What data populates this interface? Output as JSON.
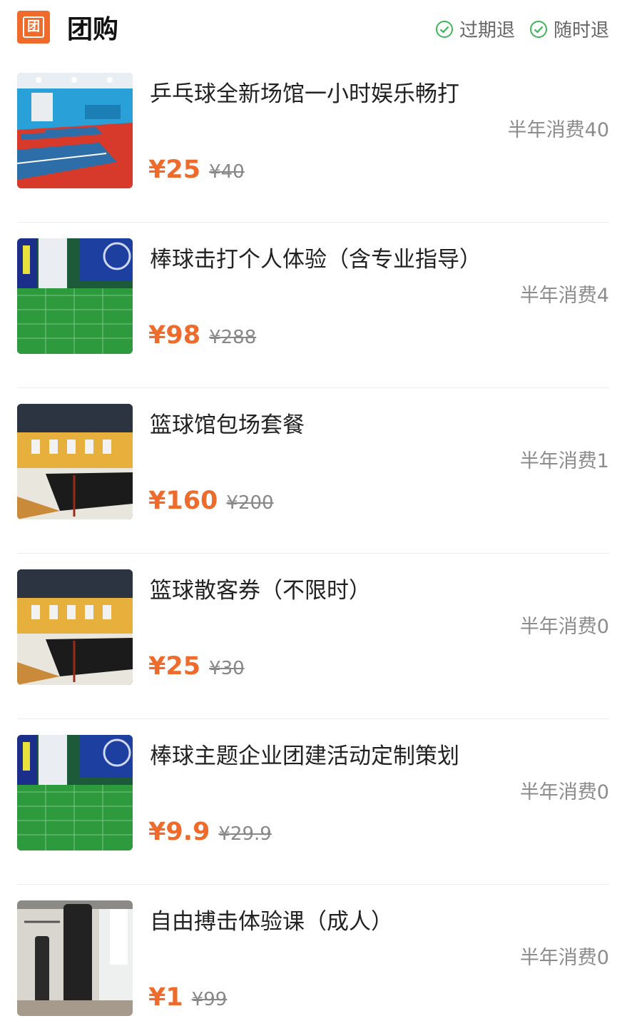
{
  "header": {
    "logo_char": "团",
    "title": "团购",
    "tags": [
      {
        "icon": "check-circle-icon",
        "label": "过期退"
      },
      {
        "icon": "check-circle-icon",
        "label": "随时退"
      }
    ]
  },
  "deals": [
    {
      "title": "乒乓球全新场馆一小时娱乐畅打",
      "sales": "半年消费40",
      "price": "¥25",
      "original": "¥40",
      "image": "table-tennis-hall-photo"
    },
    {
      "title": "棒球击打个人体验（含专业指导）",
      "sales": "半年消费4",
      "price": "¥98",
      "original": "¥288",
      "image": "baseball-batting-cage-photo"
    },
    {
      "title": "篮球馆包场套餐",
      "sales": "半年消费1",
      "price": "¥160",
      "original": "¥200",
      "image": "basketball-court-photo"
    },
    {
      "title": "篮球散客券（不限时）",
      "sales": "半年消费0",
      "price": "¥25",
      "original": "¥30",
      "image": "basketball-court-photo"
    },
    {
      "title": "棒球主题企业团建活动定制策划",
      "sales": "半年消费0",
      "price": "¥9.9",
      "original": "¥29.9",
      "image": "baseball-batting-cage-photo"
    },
    {
      "title": "自由搏击体验课（成人）",
      "sales": "半年消费0",
      "price": "¥1",
      "original": "¥99",
      "image": "boxing-gym-photo"
    }
  ],
  "colors": {
    "accent": "#ef6b2c",
    "check": "#3fb55a"
  }
}
